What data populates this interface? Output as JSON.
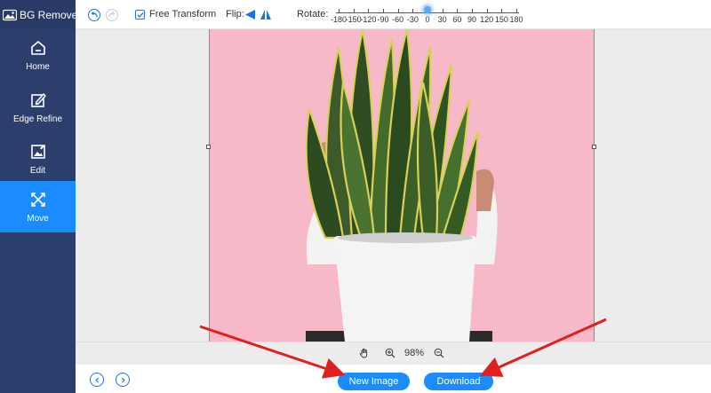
{
  "app": {
    "title": "BG Remover"
  },
  "sidebar": {
    "items": [
      {
        "label": "Home",
        "icon": "home-icon"
      },
      {
        "label": "Edge Refine",
        "icon": "edit-pencil-icon"
      },
      {
        "label": "Edit",
        "icon": "image-edit-icon"
      },
      {
        "label": "Move",
        "icon": "move-icon",
        "active": true
      }
    ]
  },
  "toolbar": {
    "free_transform_label": "Free Transform",
    "free_transform_checked": true,
    "flip_label": "Flip:",
    "rotate_label": "Rotate:",
    "rotate_ticks": [
      "-180",
      "-150",
      "-120",
      "-90",
      "-60",
      "-30",
      "0",
      "30",
      "60",
      "90",
      "120",
      "150",
      "180"
    ],
    "rotate_value": 0
  },
  "zoom": {
    "value": "98%"
  },
  "footer": {
    "new_image_label": "New Image",
    "download_label": "Download"
  },
  "colors": {
    "sidebar_bg": "#2c3e6b",
    "accent": "#1a8cff",
    "canvas_bg": "#f7b9c7",
    "arrow": "#e02020"
  }
}
